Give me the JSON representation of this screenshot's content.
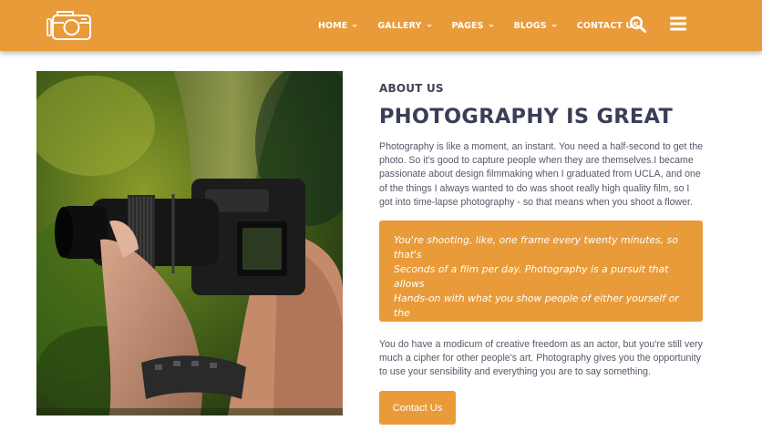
{
  "colors": {
    "accent": "#e99b39",
    "heading": "#3a3e56",
    "text": "#555868",
    "white": "#ffffff"
  },
  "brand": {
    "logo_icon": "camera-icon"
  },
  "nav": {
    "items": [
      {
        "label": "HOME",
        "has_dropdown": true
      },
      {
        "label": "GALLERY",
        "has_dropdown": true
      },
      {
        "label": "PAGES",
        "has_dropdown": true
      },
      {
        "label": "BLOGS",
        "has_dropdown": true
      },
      {
        "label": "CONTACT US",
        "has_dropdown": false
      }
    ],
    "search_icon": "search-icon",
    "menu_icon": "hamburger-menu-icon"
  },
  "hero_image": {
    "subject": "hands holding a DSLR camera in a forest"
  },
  "about": {
    "eyebrow": "ABOUT US",
    "title": "PHOTOGRAPHY IS GREAT",
    "paragraph1": "Photography is like a moment, an instant. You need a half-second to get the photo. So it's good to capture people when they are themselves.I became passionate about design filmmaking when I graduated from UCLA, and one of the things I always wanted to do was shoot really high quality film, so I got into time-lapse photography - so that means when you shoot a flower.",
    "quote_lines": [
      "You're shooting, like, one frame every twenty minutes, so that's",
      "Seconds of a film per day. Photography is a pursuit that allows",
      "Hands-on with what you show people of either yourself or the"
    ],
    "paragraph2": "You do have a modicum of creative freedom as an actor, but you're still very much a cipher for other people's art. Photography gives you the opportunity to use your sensibility and everything you are to say something.",
    "cta_label": "Contact Us"
  }
}
